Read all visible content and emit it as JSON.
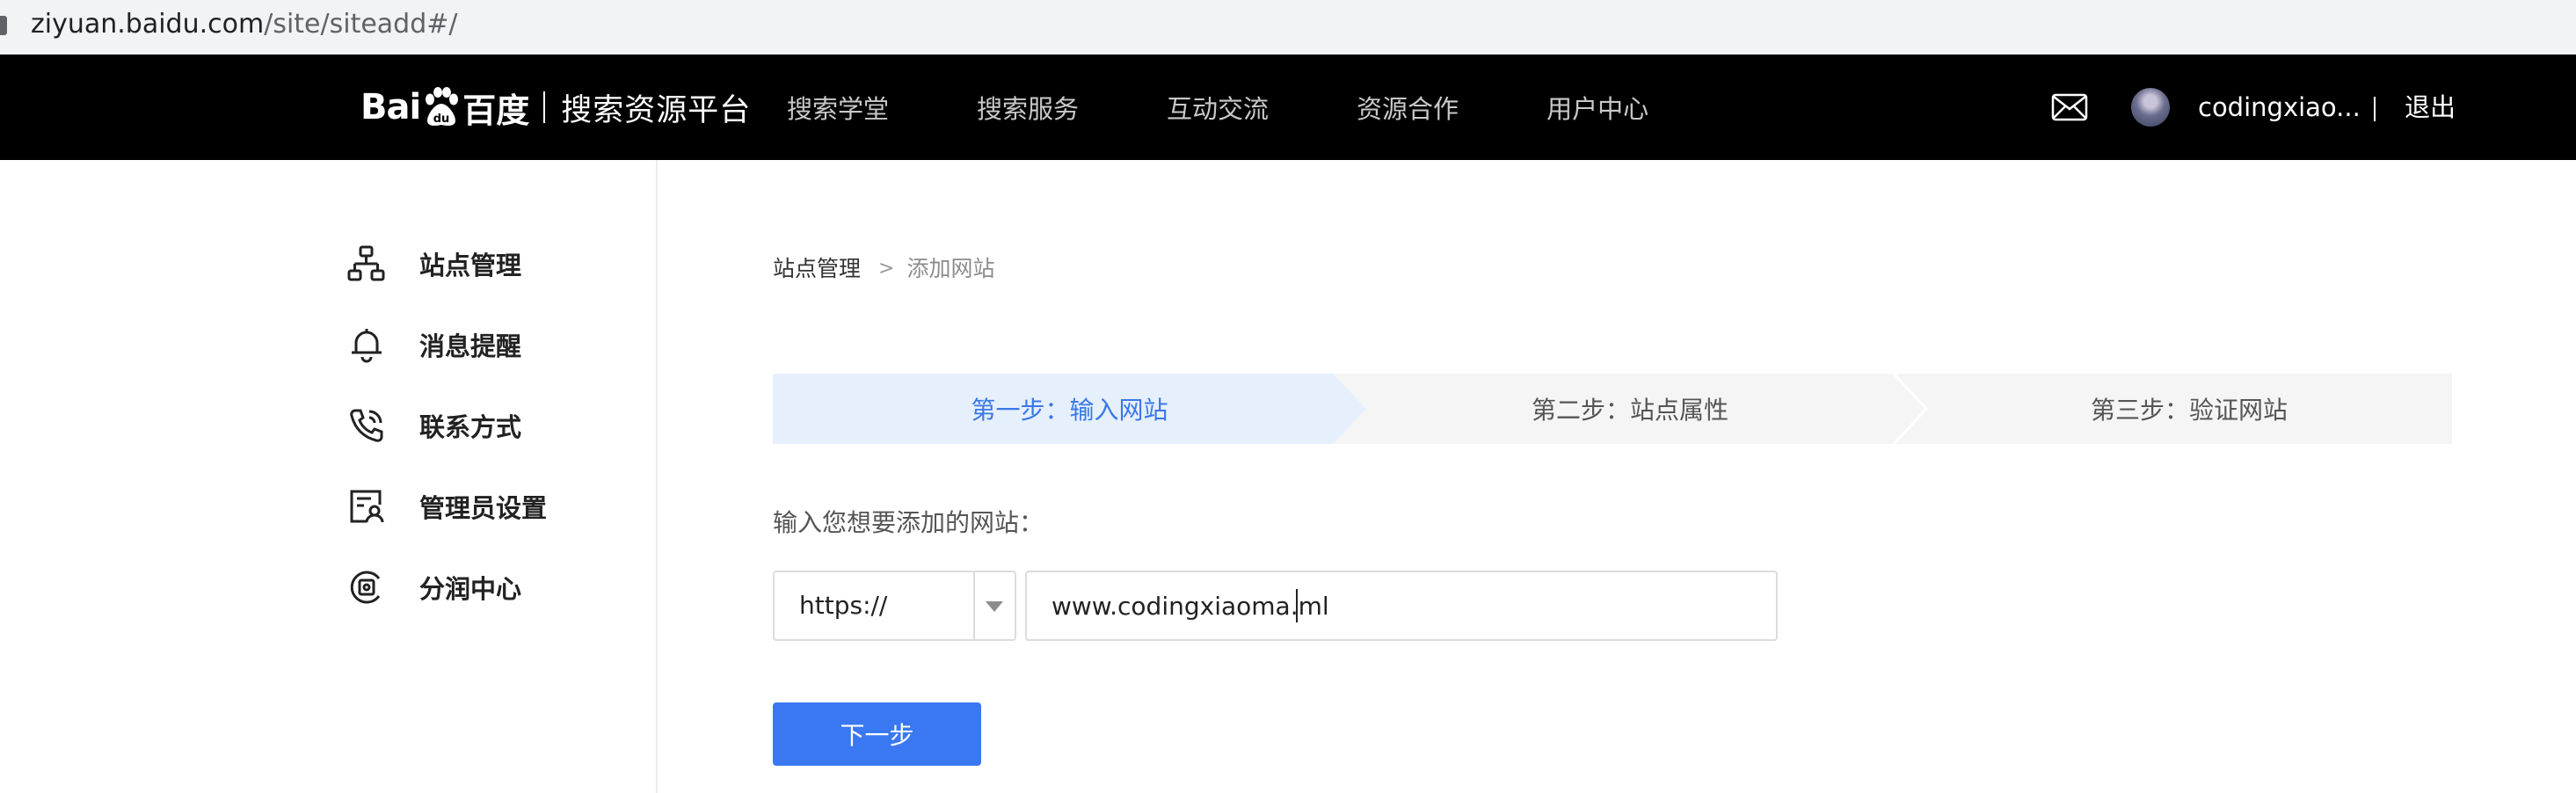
{
  "browser": {
    "url_host": "ziyuan.baidu.com",
    "url_path": "/site/siteadd#/"
  },
  "header": {
    "brand_bai": "Bai",
    "brand_du": "百度",
    "platform_name": "搜索资源平台",
    "nav": [
      "搜索学堂",
      "搜索服务",
      "互动交流",
      "资源合作",
      "用户中心"
    ],
    "username": "codingxiao...",
    "logout": "退出"
  },
  "sidebar": {
    "items": [
      {
        "label": "站点管理",
        "icon": "sitemap-icon"
      },
      {
        "label": "消息提醒",
        "icon": "bell-icon"
      },
      {
        "label": "联系方式",
        "icon": "phone-icon"
      },
      {
        "label": "管理员设置",
        "icon": "admin-icon"
      },
      {
        "label": "分润中心",
        "icon": "revenue-icon"
      }
    ]
  },
  "breadcrumb": {
    "parent": "站点管理",
    "current": "添加网站"
  },
  "steps": [
    {
      "label": "第一步：输入网站",
      "active": true
    },
    {
      "label": "第二步：站点属性",
      "active": false
    },
    {
      "label": "第三步：验证网站",
      "active": false
    }
  ],
  "form": {
    "prompt": "输入您想要添加的网站：",
    "protocol": "https://",
    "site_value": "www.codingxiaoma.ml",
    "next_button": "下一步"
  },
  "colors": {
    "accent": "#3a78f2",
    "active_step_bg": "#e6effc",
    "nav_bg": "#000000"
  }
}
